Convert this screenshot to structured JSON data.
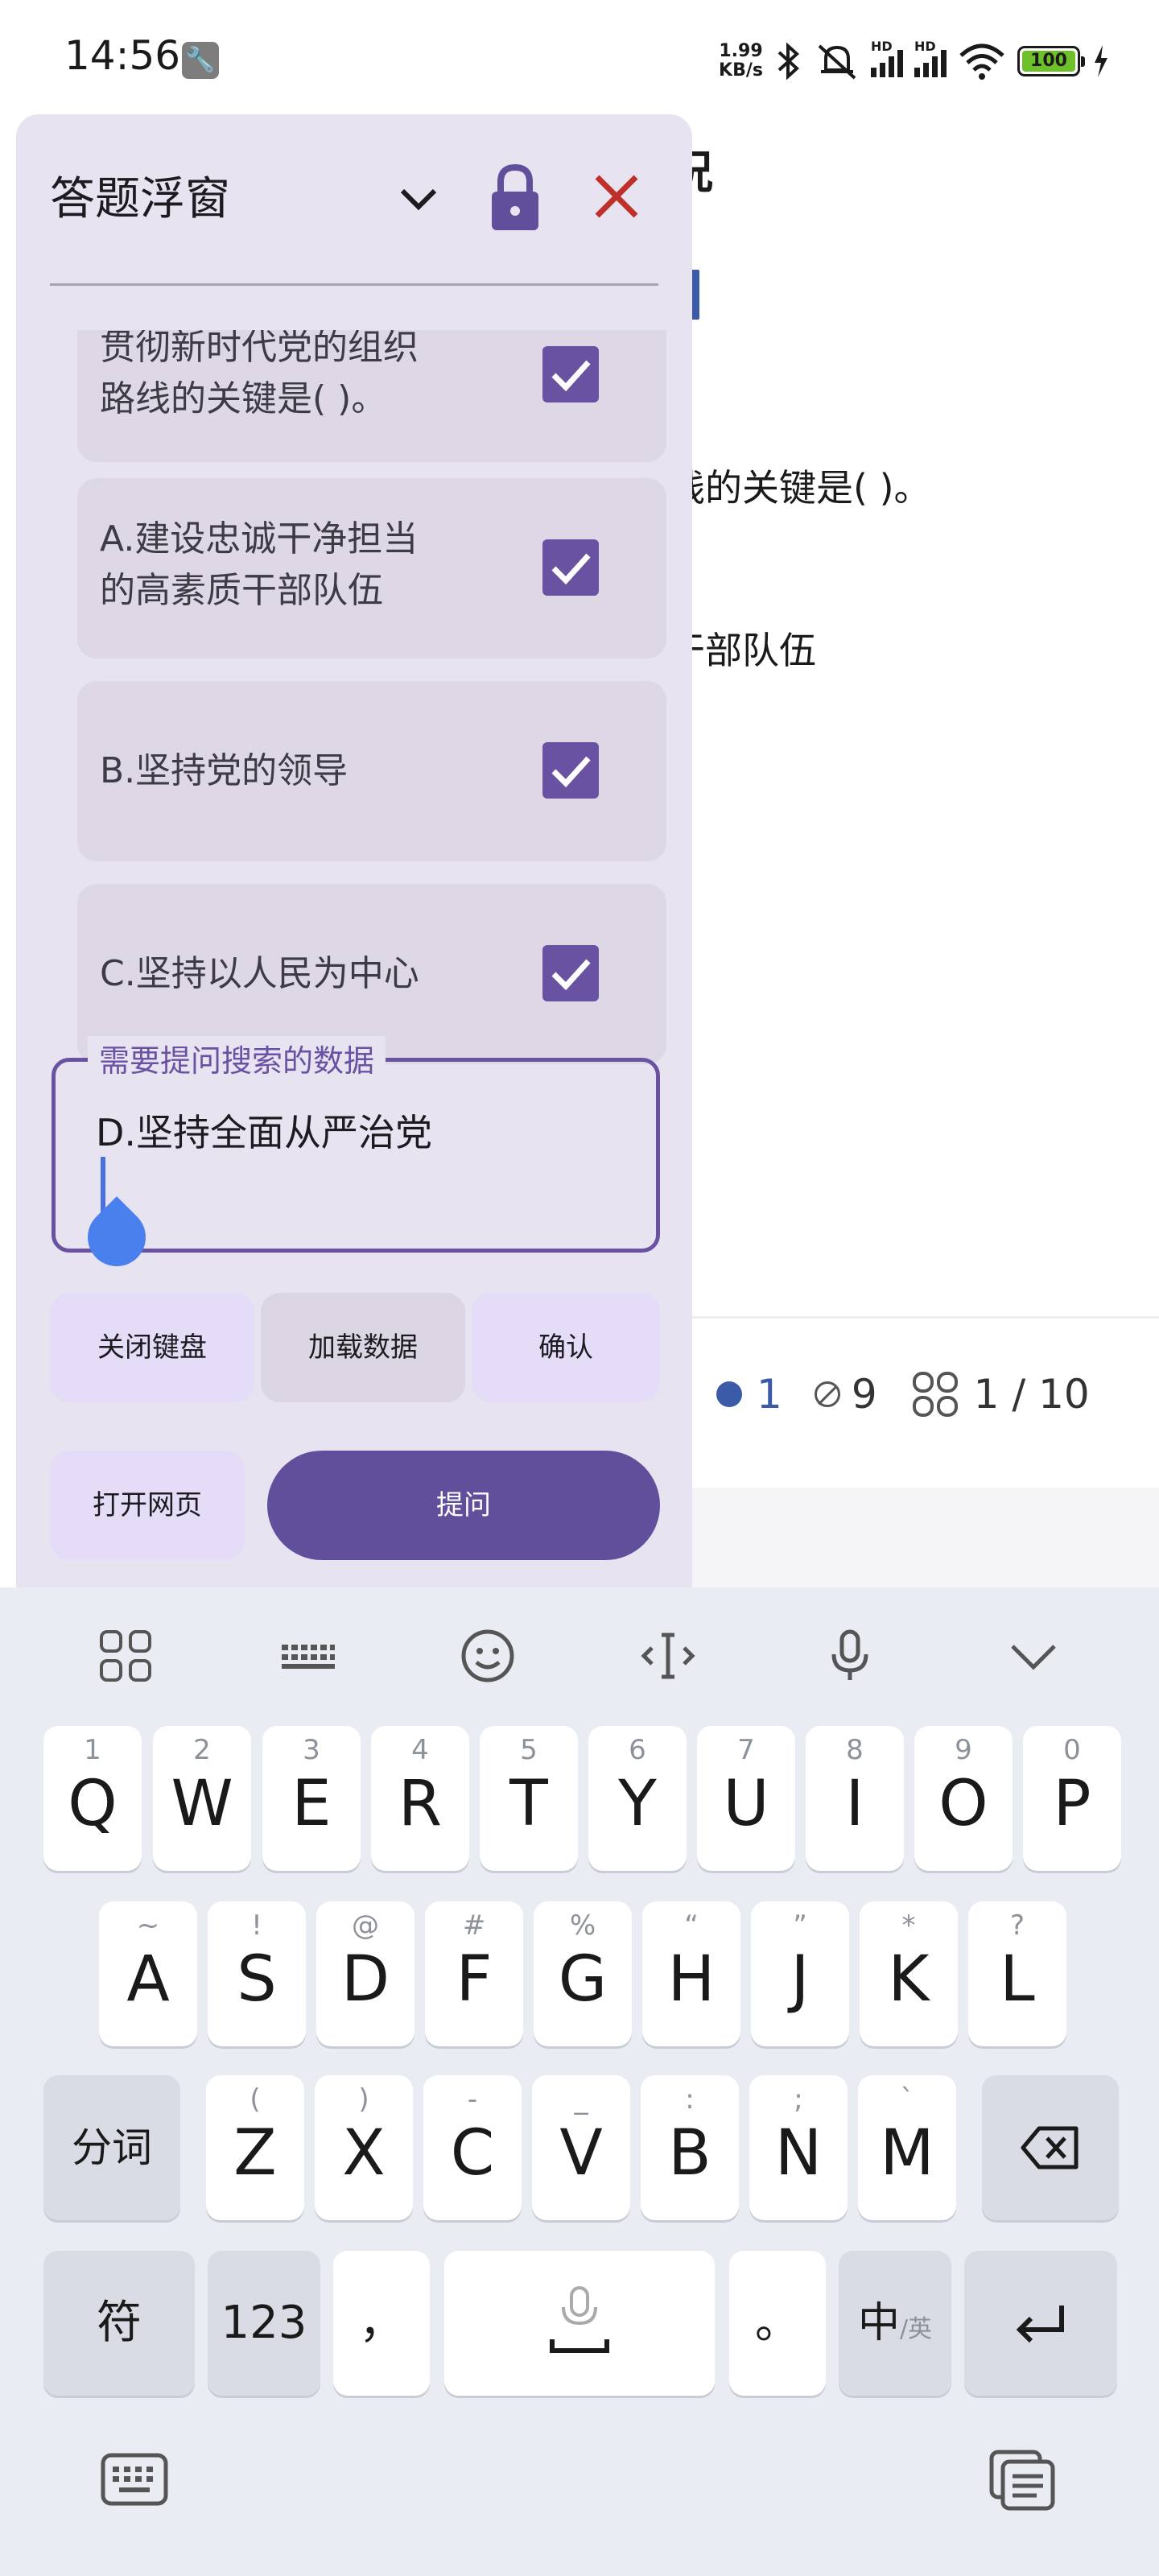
{
  "status_bar": {
    "time": "14:56",
    "net_speed_value": "1.99",
    "net_speed_unit": "KB/s",
    "hd1": "HD",
    "hd2": "HD",
    "battery": "100"
  },
  "background_page": {
    "title_fragment": "况",
    "question_fragment": "线的关键是( )。",
    "answer_fragment": "干部队伍",
    "stats": {
      "answered": "1",
      "skipped": "9",
      "progress": "1 / 10"
    },
    "accent_color": "#3b5aa8"
  },
  "panel": {
    "title": "答题浮窗",
    "options": [
      {
        "text_line1": "贯彻新时代党的组织",
        "text_line2": "路线的关键是( )。",
        "checked": true
      },
      {
        "text_line1": "A.建设忠诚干净担当",
        "text_line2": "的高素质干部队伍",
        "checked": true
      },
      {
        "text_line1": "B.坚持党的领导",
        "text_line2": "",
        "checked": true
      },
      {
        "text_line1": "C.坚持以人民为中心",
        "text_line2": "",
        "checked": true
      }
    ],
    "input": {
      "label": "需要提问搜索的数据",
      "value": "D.坚持全面从严治党"
    },
    "buttons": {
      "close_keyboard": "关闭键盘",
      "load_data": "加载数据",
      "confirm": "确认",
      "open_webpage": "打开网页",
      "ask": "提问"
    },
    "accent_color": "#6a52a3"
  },
  "keyboard": {
    "row1": [
      {
        "hint": "1",
        "key": "Q"
      },
      {
        "hint": "2",
        "key": "W"
      },
      {
        "hint": "3",
        "key": "E"
      },
      {
        "hint": "4",
        "key": "R"
      },
      {
        "hint": "5",
        "key": "T"
      },
      {
        "hint": "6",
        "key": "Y"
      },
      {
        "hint": "7",
        "key": "U"
      },
      {
        "hint": "8",
        "key": "I"
      },
      {
        "hint": "9",
        "key": "O"
      },
      {
        "hint": "0",
        "key": "P"
      }
    ],
    "row2": [
      {
        "hint": "~",
        "key": "A"
      },
      {
        "hint": "!",
        "key": "S"
      },
      {
        "hint": "@",
        "key": "D"
      },
      {
        "hint": "#",
        "key": "F"
      },
      {
        "hint": "%",
        "key": "G"
      },
      {
        "hint": "“",
        "key": "H"
      },
      {
        "hint": "”",
        "key": "J"
      },
      {
        "hint": "*",
        "key": "K"
      },
      {
        "hint": "?",
        "key": "L"
      }
    ],
    "row3": [
      {
        "hint": "(",
        "key": "Z"
      },
      {
        "hint": ")",
        "key": "X"
      },
      {
        "hint": "-",
        "key": "C"
      },
      {
        "hint": "_",
        "key": "V"
      },
      {
        "hint": ":",
        "key": "B"
      },
      {
        "hint": ";",
        "key": "N"
      },
      {
        "hint": "`",
        "key": "M"
      }
    ],
    "segment_key": "分词",
    "symbol_key": "符",
    "number_key": "123",
    "comma_key": "，",
    "period_key": "。",
    "lang_key_main": "中",
    "lang_key_sub": "/英"
  }
}
